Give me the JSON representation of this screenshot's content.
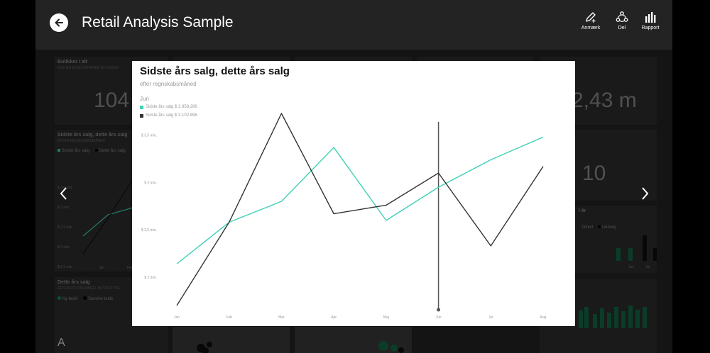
{
  "header": {
    "title": "Retail Analysis Sample",
    "tools": [
      {
        "label": "Anmærk",
        "icon": "pen-icon"
      },
      {
        "label": "Del",
        "icon": "share-icon"
      },
      {
        "label": "Rapport",
        "icon": "report-bar-icon"
      }
    ]
  },
  "background_tiles": {
    "stores_title": "Butikker i alt",
    "stores_sub": "NYE OG EKSISTERENDE BUTIKKER",
    "stores_value": "104",
    "sales_value": "2,43 m",
    "count_value": "10",
    "chart_title": "Sidste års salg, dette års salg",
    "chart_sub": "EFTER REGNSKABSMÅNED",
    "legend_a": "Sidste års salg",
    "legend_b": "Dette års salg",
    "y_ticks": [
      "$ 3,0 mio.",
      "$ 3 mio.",
      "$ 2,5 mio.",
      "$ 2 mio.",
      "$ 1,5 mio."
    ],
    "x_ticks": [
      "Jan",
      "Feb"
    ],
    "this_year_title": "Dette års salg",
    "this_year_sub": "EFTER POSTNUMMER, BUTIKSTYPE",
    "ny_butik": "Ny butik",
    "samme_butik": "Samme butik",
    "right_title": "l år",
    "right_legend_a": "Direct",
    "right_legend_b": "Lindsey",
    "right_x": [
      "Jun",
      "Jul"
    ],
    "right_tile_letter": "A"
  },
  "modal": {
    "title": "Sidste års salg, dette års salg",
    "subtitle": "efter regnskabsmåned",
    "tooltip_header": "Jun",
    "tooltip_items": [
      {
        "label": "Sidste års salg $ 2.958.286",
        "color": "#3fd0b6"
      },
      {
        "label": "Sidste års salg $ 3.102.896",
        "color": "#333333"
      }
    ]
  },
  "chart_data": {
    "type": "line",
    "title": "Sidste års salg, dette års salg",
    "subtitle": "efter regnskabsmåned",
    "categories": [
      "Jan",
      "Feb",
      "Mar",
      "Apr",
      "Maj",
      "Jun",
      "Jul",
      "Aug"
    ],
    "y_tick_labels": [
      "$ 3,5 mio.",
      "$ 3 mio.",
      "$ 2,5 mio.",
      "$ 2 mio."
    ],
    "y_tick_values": [
      3.5,
      3.0,
      2.5,
      2.0
    ],
    "ylim": [
      1.7,
      3.7
    ],
    "series": [
      {
        "name": "Sidste års salg",
        "color": "#3fd0b6",
        "values": [
          2.14,
          2.58,
          2.8,
          3.37,
          2.6,
          2.95,
          3.24,
          3.48
        ]
      },
      {
        "name": "Dette års salg",
        "color": "#333333",
        "values": [
          1.7,
          2.58,
          3.73,
          2.67,
          2.76,
          3.1,
          2.33,
          3.17
        ]
      }
    ],
    "highlight_category": "Jun",
    "grid": false
  },
  "colors": {
    "teal": "#3fd0b6",
    "dark": "#333333",
    "app_bg": "#232323"
  }
}
